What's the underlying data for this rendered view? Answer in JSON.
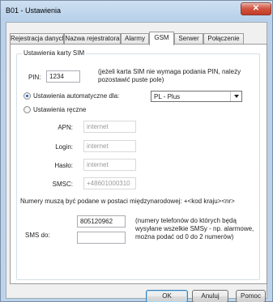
{
  "window": {
    "title": "B01 - Ustawienia"
  },
  "tabs": [
    {
      "label": "Rejestracja danych"
    },
    {
      "label": "Nazwa rejestratora"
    },
    {
      "label": "Alarmy"
    },
    {
      "label": "GSM"
    },
    {
      "label": "Serwer"
    },
    {
      "label": "Połączenie"
    }
  ],
  "active_tab": "GSM",
  "group": {
    "legend": "Ustawienia karty SIM",
    "pin": {
      "label": "PIN:",
      "value": "1234",
      "note": "(jeżeli karta SIM nie wymaga podania PIN, należy pozostawić puste pole)"
    },
    "auto_radio": {
      "label": "Ustawienia automatyczne dla:",
      "checked": true
    },
    "operator_select": {
      "value": "PL - Plus"
    },
    "manual_radio": {
      "label": "Ustawienia ręczne",
      "checked": false
    },
    "apn": {
      "label": "APN:",
      "value": "internet"
    },
    "login": {
      "label": "Login:",
      "value": "internet"
    },
    "password": {
      "label": "Hasło:",
      "value": "internet"
    },
    "smsc": {
      "label": "SMSC:",
      "value": "+48601000310"
    },
    "intl_note": "Numery muszą być podane w postaci międzynarodowej: +<kod kraju><nr>",
    "sms": {
      "label": "SMS do:",
      "number1": "805120962",
      "number2": "",
      "note": "(numery telefonów do których będą wysyłane wszelkie SMSy - np. alarmowe, można podać od 0 do 2 numerów)"
    }
  },
  "buttons": {
    "ok": "OK",
    "cancel": "Anuluj",
    "help": "Pomoc"
  },
  "colors": {
    "radio_dot": "#1b5fb0",
    "close_button": "#c23b26",
    "default_button_border": "#3c7fb1"
  }
}
